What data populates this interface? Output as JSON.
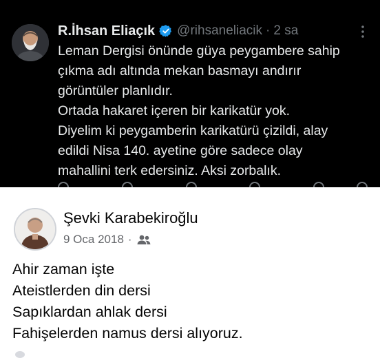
{
  "tweet": {
    "author_name": "R.İhsan Eliaçık",
    "handle": "@rihsaneliacik",
    "separator": "·",
    "time": "2 sa",
    "verified_icon": "verified-badge-icon",
    "more_icon": "more-vertical-icon",
    "lines": [
      "Leman Dergisi önünde güya peygambere sahip",
      "çıkma adı altında mekan basmayı andırır",
      "görüntüler planlıdır.",
      "Ortada hakaret içeren bir karikatür yok.",
      "Diyelim ki peygamberin karikatürü çizildi, alay",
      "edildi Nisa 140. ayetine göre sadece olay",
      "mahallini terk edersiniz. Aksi zorbalık."
    ],
    "colors": {
      "background": "#000000",
      "text": "#e7e9ea",
      "muted": "#71767b",
      "verified": "#1d9bf0"
    }
  },
  "facebook_post": {
    "author_name": "Şevki Karabekiroğlu",
    "date": "9 Oca 2018",
    "separator": "·",
    "audience_icon": "friends-icon",
    "lines": [
      "Ahir zaman işte",
      "Ateistlerden din dersi",
      "Sapıklardan ahlak dersi",
      "Fahişelerden namus dersi alıyoruz."
    ],
    "colors": {
      "background": "#ffffff",
      "text": "#050505",
      "muted": "#65676b"
    }
  }
}
